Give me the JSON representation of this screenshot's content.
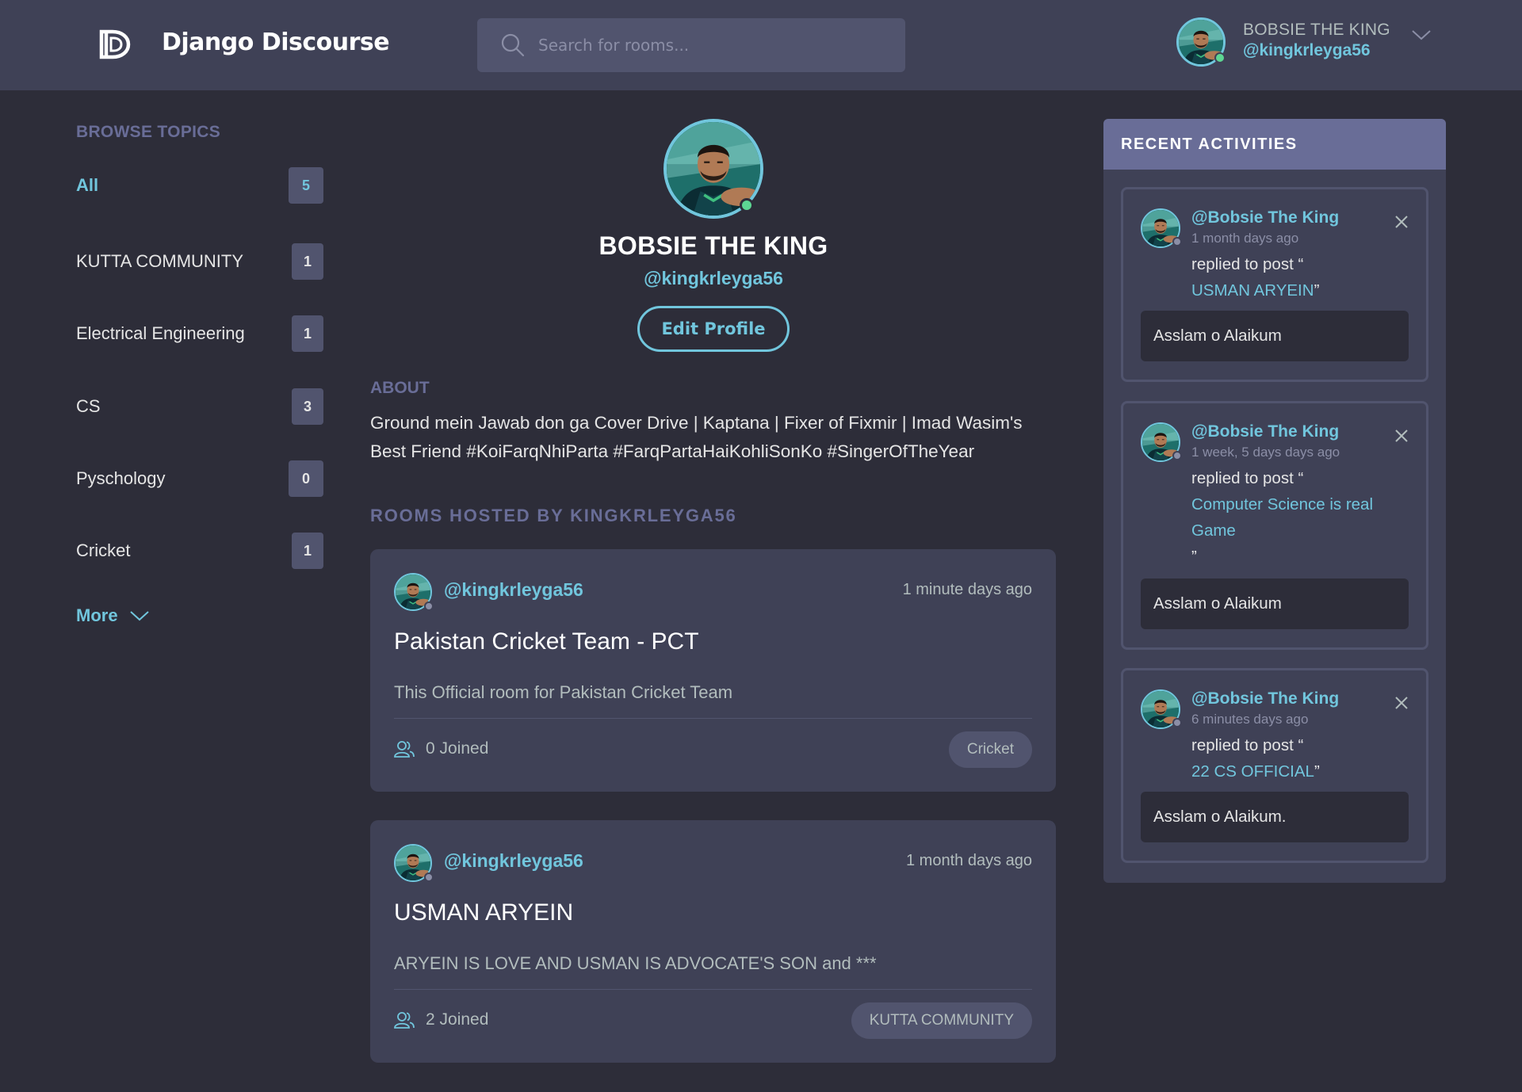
{
  "header": {
    "brand": "Django Discourse",
    "logo_icon": "django-discourse-logo-icon",
    "search": {
      "placeholder": "Search for rooms..."
    },
    "user": {
      "name": "BOBSIE THE KING",
      "handle": "@kingkrleyga56",
      "online": true
    }
  },
  "sidebar": {
    "title": "BROWSE TOPICS",
    "topics": [
      {
        "label": "All",
        "count": "5",
        "active": true
      },
      {
        "label": "KUTTA COMMUNITY",
        "count": "1"
      },
      {
        "label": "Electrical Engineering",
        "count": "1"
      },
      {
        "label": "CS",
        "count": "3"
      },
      {
        "label": "Pyschology",
        "count": "0"
      },
      {
        "label": "Cricket",
        "count": "1"
      }
    ],
    "more_label": "More"
  },
  "profile": {
    "name": "BOBSIE THE KING",
    "handle": "@kingkrleyga56",
    "edit_label": "Edit Profile",
    "about_title": "ABOUT",
    "about_text": "Ground mein Jawab don ga Cover Drive | Kaptana | Fixer of Fixmir | Imad Wasim's Best Friend #KoiFarqNhiParta #FarqPartaHaiKohliSonKo #SingerOfTheYear",
    "rooms_title": "ROOMS HOSTED BY KINGKRLEYGA56"
  },
  "rooms": [
    {
      "host": "@kingkrleyga56",
      "time": "1 minute days ago",
      "title": "Pakistan Cricket Team - PCT",
      "description": "This Official room for Pakistan Cricket Team",
      "joined": "0 Joined",
      "topic": "Cricket"
    },
    {
      "host": "@kingkrleyga56",
      "time": "1 month days ago",
      "title": "USMAN ARYEIN",
      "description": "ARYEIN IS LOVE AND USMAN IS ADVOCATE'S SON and ***",
      "joined": "2 Joined",
      "topic": "KUTTA COMMUNITY"
    }
  ],
  "activities": {
    "title": "RECENT ACTIVITIES",
    "items": [
      {
        "user": "@Bobsie The King",
        "time": "1 month days ago",
        "action": "replied to post “",
        "post": "USMAN ARYEIN",
        "post_close": "”",
        "message": "Asslam o Alaikum"
      },
      {
        "user": "@Bobsie The King",
        "time": "1 week, 5 days days ago",
        "action": "replied to post “",
        "post": "Computer Science is real Game",
        "post_close": "”",
        "message": "Asslam o Alaikum"
      },
      {
        "user": "@Bobsie The King",
        "time": "6 minutes days ago",
        "action": "replied to post “",
        "post": "22 CS OFFICIAL",
        "post_close": "”",
        "message": "Asslam o Alaikum."
      }
    ]
  },
  "colors": {
    "background": "#2d2d39",
    "surface": "#3f4156",
    "surface_light": "#51546e",
    "accent": "#71c6dd",
    "muted": "#696d97",
    "online": "#5dd693"
  }
}
